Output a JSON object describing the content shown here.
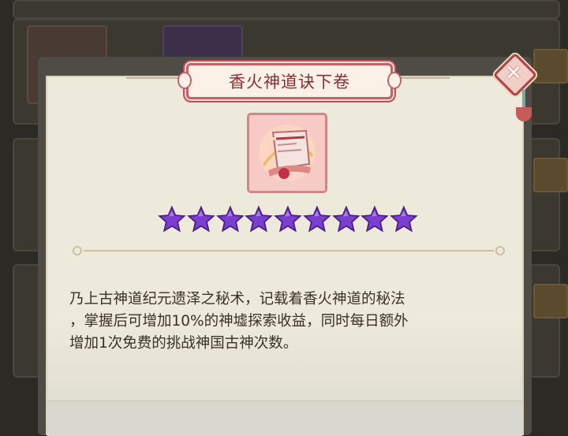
{
  "dialog": {
    "title": "香火神道诀下卷",
    "item": {
      "name": "香火神道诀下卷",
      "icon": "scroll-icon",
      "star_count": 9,
      "star_color": "#7b3fd0"
    },
    "description_lines": [
      "乃上古神道纪元遗泽之秘术，记载着香火神道的秘法",
      "，掌握后可增加10%的神墟探索收益，同时每日额外",
      "增加1次免费的挑战神国古神次数。"
    ],
    "close_icon": "close-icon"
  },
  "colors": {
    "accent": "#b23f49",
    "title_text": "#8a2e34",
    "panel_bg": "#eeeadb",
    "star": "#7b3fd0"
  }
}
